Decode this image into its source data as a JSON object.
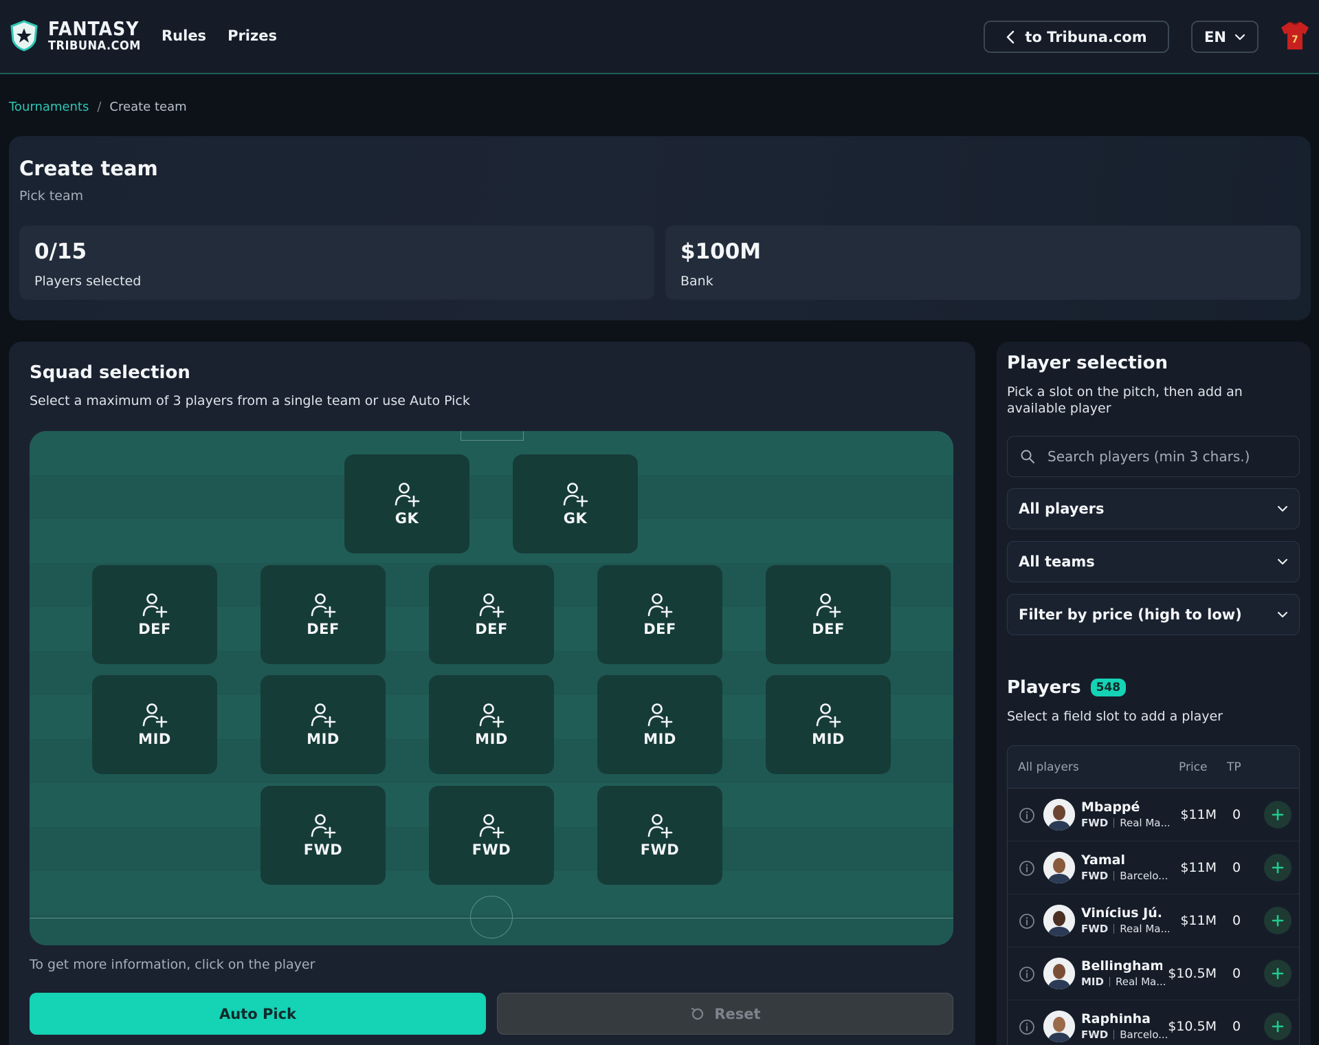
{
  "header": {
    "logo_line1": "FANTASY",
    "logo_line2": "TRIBUNA.COM",
    "nav": [
      "Rules",
      "Prizes"
    ],
    "back_label": "to Tribuna.com",
    "lang": "EN",
    "user_shirt_number": "7"
  },
  "breadcrumb": {
    "root": "Tournaments",
    "separator": "/",
    "current": "Create team"
  },
  "create": {
    "title": "Create team",
    "subtitle": "Pick team",
    "players_selected_value": "0/15",
    "players_selected_label": "Players selected",
    "bank_value": "$100M",
    "bank_label": "Bank"
  },
  "squad": {
    "title": "Squad selection",
    "subtitle": "Select a maximum of 3 players from a single team or use Auto Pick",
    "slots": {
      "gk": [
        "GK",
        "GK"
      ],
      "def": [
        "DEF",
        "DEF",
        "DEF",
        "DEF",
        "DEF"
      ],
      "mid": [
        "MID",
        "MID",
        "MID",
        "MID",
        "MID"
      ],
      "fwd": [
        "FWD",
        "FWD",
        "FWD"
      ]
    },
    "hint": "To get more information, click on the player",
    "auto_pick_label": "Auto Pick",
    "reset_label": "Reset"
  },
  "selection": {
    "title": "Player selection",
    "subtitle": "Pick a slot on the pitch, then add an available player",
    "search_placeholder": "Search players (min 3 chars.)",
    "filter_players": "All players",
    "filter_teams": "All teams",
    "filter_price": "Filter by price (high to low)",
    "players_title": "Players",
    "players_count": "548",
    "players_subtitle": "Select a field slot to add a player",
    "columns": {
      "name": "All players",
      "price": "Price",
      "tp": "TP"
    },
    "rows": [
      {
        "name": "Mbappé",
        "pos": "FWD",
        "club": "Real Ma...",
        "price": "$11M",
        "tp": "0",
        "skin": "#6b4530"
      },
      {
        "name": "Yamal",
        "pos": "FWD",
        "club": "Barcelo...",
        "price": "$11M",
        "tp": "0",
        "skin": "#8a5a3c"
      },
      {
        "name": "Vinícius Jú...",
        "pos": "FWD",
        "club": "Real Ma...",
        "price": "$11M",
        "tp": "0",
        "skin": "#4a2f22"
      },
      {
        "name": "Bellingham",
        "pos": "MID",
        "club": "Real Ma...",
        "price": "$10.5M",
        "tp": "0",
        "skin": "#7a4e36"
      },
      {
        "name": "Raphinha",
        "pos": "FWD",
        "club": "Barcelo...",
        "price": "$10.5M",
        "tp": "0",
        "skin": "#9a6a4a"
      }
    ]
  },
  "colors": {
    "accent": "#15d3b5",
    "pitch": "#215d57",
    "slot": "#163c38",
    "bg": "#0d1219"
  }
}
